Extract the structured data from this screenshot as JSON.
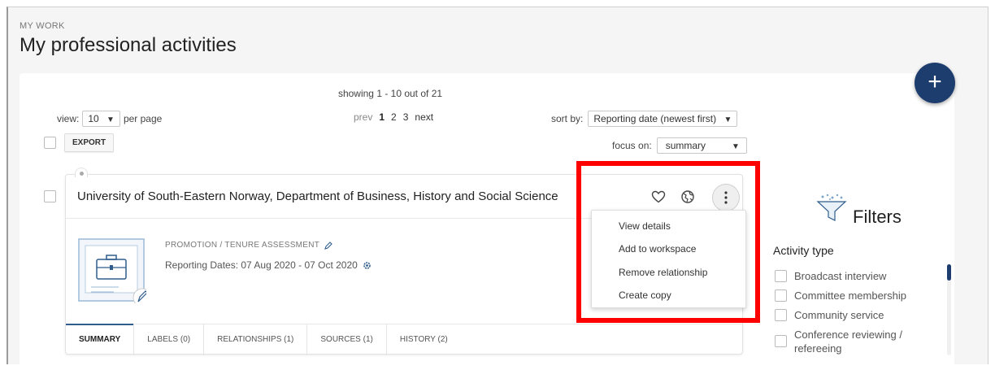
{
  "header": {
    "section_label": "MY WORK",
    "title": "My professional activities"
  },
  "fab": {
    "label": "+"
  },
  "pagination": {
    "showing": "showing 1 - 10 out of 21",
    "view_label": "view:",
    "per_page_value": "10",
    "per_page_label": "per page",
    "prev": "prev",
    "pages": [
      "1",
      "2",
      "3"
    ],
    "current_page": "1",
    "next": "next"
  },
  "sort": {
    "label": "sort by:",
    "value": "Reporting date (newest first)"
  },
  "toolbar": {
    "export_label": "EXPORT"
  },
  "focus": {
    "label": "focus on:",
    "value": "summary"
  },
  "card": {
    "title": "University of South-Eastern Norway, Department of Business, History and Social Science",
    "type_label": "PROMOTION / TENURE ASSESSMENT",
    "dates": "Reporting Dates: 07 Aug 2020 - 07 Oct 2020",
    "tabs": [
      "SUMMARY",
      "LABELS (0)",
      "RELATIONSHIPS (1)",
      "SOURCES (1)",
      "HISTORY (2)"
    ]
  },
  "menu": {
    "items": [
      "View details",
      "Add to workspace",
      "Remove relationship",
      "Create copy"
    ]
  },
  "filters": {
    "title": "Filters",
    "heading": "Activity type",
    "items": [
      "Broadcast interview",
      "Committee membership",
      "Community service",
      "Conference reviewing /",
      "refereeing"
    ]
  },
  "colors": {
    "accent": "#1d3d6e",
    "highlight": "#ff0000",
    "panel": "#ffffff",
    "background": "#f5f5f5"
  },
  "icons": [
    "plus-icon",
    "heart-icon",
    "globe-icon",
    "kebab-icon",
    "pencil-icon",
    "gear-icon",
    "briefcase-icon",
    "filter-funnel-icon",
    "chevron-down-icon"
  ]
}
